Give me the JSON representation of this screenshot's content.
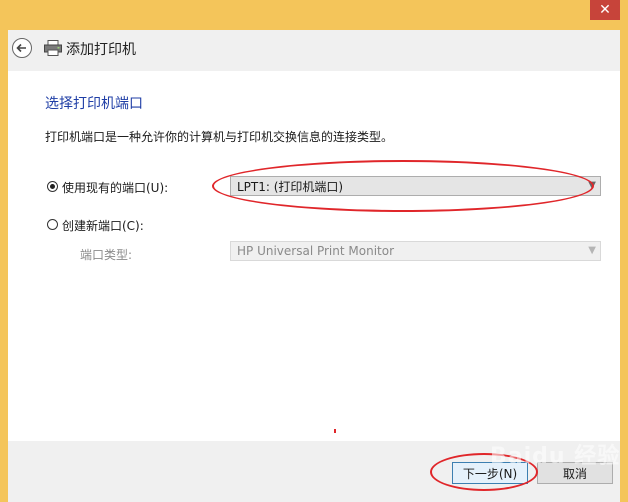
{
  "window": {
    "title": "添加打印机",
    "close_glyph": "✕"
  },
  "page": {
    "heading": "选择打印机端口",
    "description": "打印机端口是一种允许你的计算机与打印机交换信息的连接类型。"
  },
  "port_options": {
    "use_existing": {
      "label": "使用现有的端口(U):",
      "selected": true,
      "value": "LPT1: (打印机端口)"
    },
    "create_new": {
      "label": "创建新端口(C):",
      "selected": false,
      "type_label": "端口类型:",
      "type_value": "HP Universal Print Monitor"
    }
  },
  "buttons": {
    "next": "下一步(N)",
    "cancel": "取消"
  },
  "watermark": {
    "text": "Baidu 经验"
  },
  "colors": {
    "frame": "#f4c55a",
    "close": "#c7443a",
    "heading": "#1f3ea6",
    "annotation": "#e0262a"
  },
  "icons": [
    "back-arrow-icon",
    "printer-icon",
    "close-icon",
    "chevron-down-icon"
  ]
}
